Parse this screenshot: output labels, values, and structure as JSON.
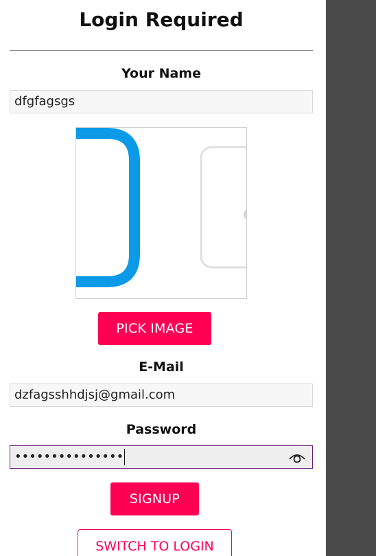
{
  "header": {
    "title": "Login Required"
  },
  "name_field": {
    "label": "Your Name",
    "value": "dfgfagsgs"
  },
  "image_picker": {
    "button_label": "PICK IMAGE"
  },
  "email_field": {
    "label": "E-Mail",
    "value": "dzfagsshhdjsj@gmail.com"
  },
  "password_field": {
    "label": "Password",
    "value": "•••••••••••••••",
    "icon": "eye-icon"
  },
  "actions": {
    "signup_label": "SIGNUP",
    "switch_label": "SWITCH TO LOGIN"
  },
  "colors": {
    "accent": "#ff0055",
    "focus_border": "#6b1f7a",
    "side_panel": "#4b4b4b",
    "preview_blue": "#0a9ae8"
  }
}
